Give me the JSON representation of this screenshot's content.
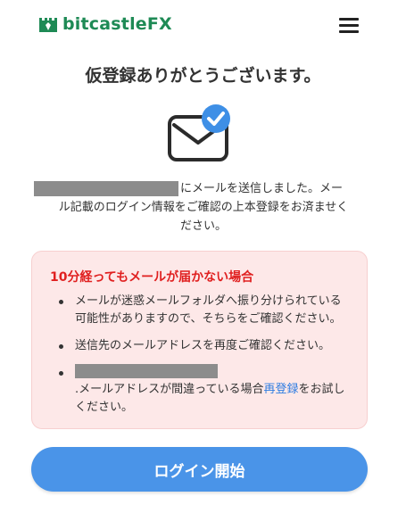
{
  "header": {
    "logo_text": "bitcastle",
    "logo_suffix": "FX",
    "menu_icon": "hamburger-menu-icon"
  },
  "title": "仮登録ありがとうございます。",
  "mail_icon": "envelope-check-icon",
  "message": {
    "line1": "にメールを送信しました。メー",
    "line2": "ル記載のログイン情報をご確認の上本登録をお済ませく",
    "line3": "ださい。"
  },
  "notice": {
    "title": "10分経ってもメールが届かない場合",
    "item1": "メールが迷惑メールフォルダへ振り分けられている可能性がありますので、そちらをご確認ください。",
    "item2": "送信先のメールアドレスを再度ご確認ください。",
    "item3_before": ".メールアドレスが間違っている場合",
    "item3_link": "再登録",
    "item3_after": "をお試しください。"
  },
  "login_button": "ログイン開始",
  "colors": {
    "brand_green": "#1e8a55",
    "primary_blue": "#4a94e8",
    "notice_bg": "#fde8e8",
    "notice_title_red": "#e02020",
    "link_blue": "#2f7de1"
  }
}
